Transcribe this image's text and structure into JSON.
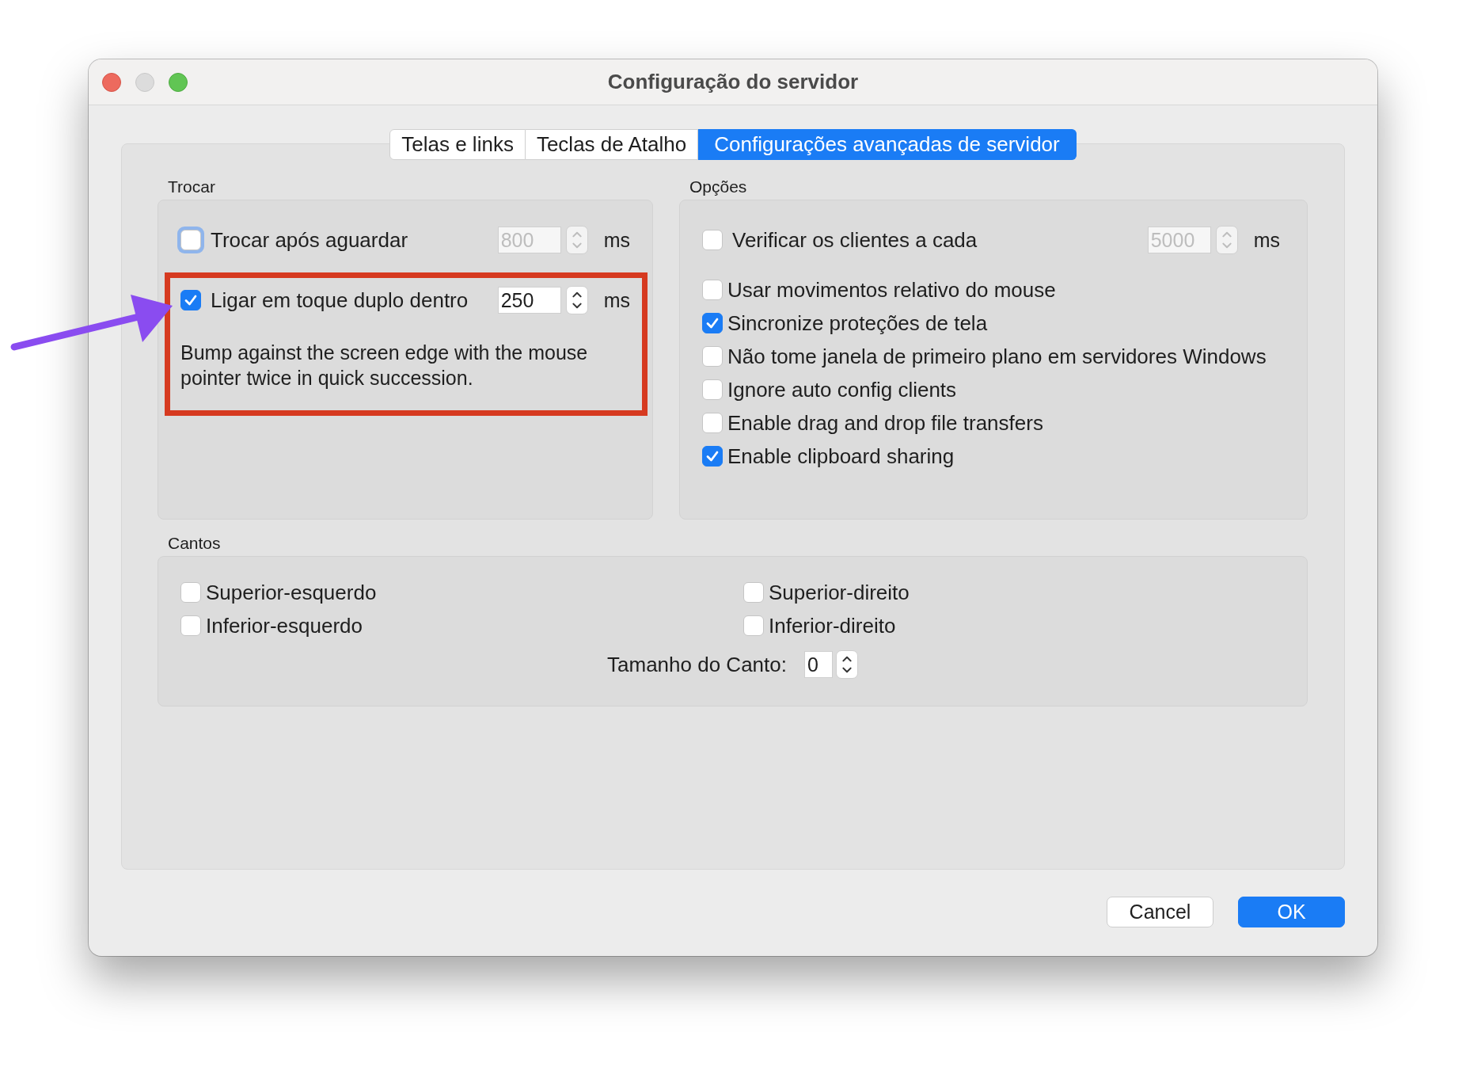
{
  "window": {
    "title": "Configuração do servidor"
  },
  "tabs": [
    {
      "label": "Telas e links",
      "selected": false
    },
    {
      "label": "Teclas de Atalho",
      "selected": false
    },
    {
      "label": "Configurações avançadas de servidor",
      "selected": true
    }
  ],
  "trocar": {
    "title": "Trocar",
    "rows": [
      {
        "label": "Trocar após aguardar",
        "checked": false,
        "focused": true,
        "value": "800",
        "disabled": true,
        "unit": "ms"
      },
      {
        "label": "Ligar em toque duplo dentro",
        "checked": true,
        "focused": false,
        "value": "250",
        "disabled": false,
        "unit": "ms"
      }
    ],
    "description": "Bump against the screen edge with the mouse pointer twice in quick succession."
  },
  "opcoes": {
    "title": "Opções",
    "interval": {
      "label": "Verificar os clientes a cada",
      "checked": false,
      "value": "5000",
      "disabled": true,
      "unit": "ms"
    },
    "options": [
      {
        "label": "Usar movimentos relativo do mouse",
        "checked": false
      },
      {
        "label": "Sincronize proteções de tela",
        "checked": true
      },
      {
        "label": "Não tome janela de primeiro plano em servidores Windows",
        "checked": false
      },
      {
        "label": "Ignore auto config clients",
        "checked": false
      },
      {
        "label": "Enable drag and drop file transfers",
        "checked": false
      },
      {
        "label": "Enable clipboard sharing",
        "checked": true
      }
    ]
  },
  "cantos": {
    "title": "Cantos",
    "corners": [
      {
        "label": "Superior-esquerdo",
        "checked": false
      },
      {
        "label": "Superior-direito",
        "checked": false
      },
      {
        "label": "Inferior-esquerdo",
        "checked": false
      },
      {
        "label": "Inferior-direito",
        "checked": false
      }
    ],
    "size_label": "Tamanho do Canto:",
    "size_value": "0"
  },
  "buttons": [
    {
      "label": "Cancel",
      "kind": "default"
    },
    {
      "label": "OK",
      "kind": "primary"
    }
  ]
}
